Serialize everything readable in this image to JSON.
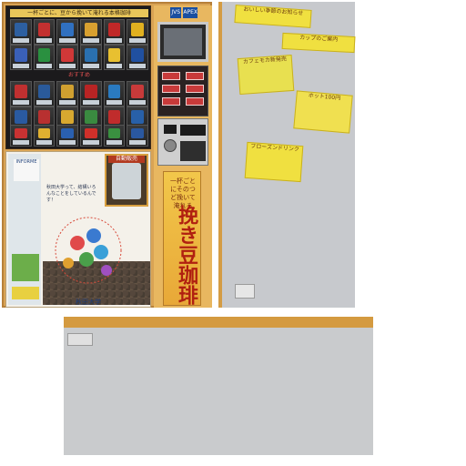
{
  "front": {
    "top_banner": "一杯ごとに、豆から挽いて淹れる本格珈琲",
    "mid_banner": "おすすめ",
    "brand_badges": [
      "JVS",
      "APEX"
    ],
    "cup_window_label": "自動販売",
    "info_sign": "INFORME",
    "info_text": "秋田大学って、結構いろんなことをしているんです！",
    "coffee_small": "一杯ごとにそのつど挽いて淹れる",
    "coffee_big": "挽き豆珈琲",
    "univ_logo": "秋田大学",
    "colors": {
      "body": "#d9a354",
      "upper_section": "#1b1a1c",
      "coffee_banner": "#f2c74a",
      "coffee_text": "#b02010"
    }
  },
  "drink_rows": [
    [
      "#2d5fa0",
      "#c33030",
      "#3070c0",
      "#d8a030",
      "#c02828",
      "#e0b020"
    ],
    [
      "#3a60b8",
      "#2a9040",
      "#d03838",
      "#2a70b0",
      "#e8c030",
      "#2050a0"
    ],
    [
      "#c03030",
      "#2a5a9a",
      "#d0a030",
      "#b82424",
      "#2a7ac0",
      "#c83a3a"
    ],
    [
      "#2a5aa0",
      "#b83030",
      "#d8a830",
      "#3a8a40",
      "#c02c2c",
      "#2860a8"
    ],
    [
      "#c83232",
      "#e0b030",
      "#2a60b0",
      "#d0302a",
      "#3a9040",
      "#2a58a0"
    ]
  ],
  "side": {
    "stickers": [
      {
        "text": "おいしい季節のお知らせ",
        "color": "#f0e040"
      },
      {
        "text": "カップのご案内",
        "color": "#f0e040"
      },
      {
        "text": "カフェモカ新発売",
        "color": "#e8e050"
      },
      {
        "text": "ホット100円",
        "color": "#f0e050"
      },
      {
        "text": "フローズンドリンク",
        "color": "#f0e040"
      }
    ]
  },
  "top_panel": {
    "color": "#c9cbcd",
    "edge_color": "#d49a40"
  }
}
